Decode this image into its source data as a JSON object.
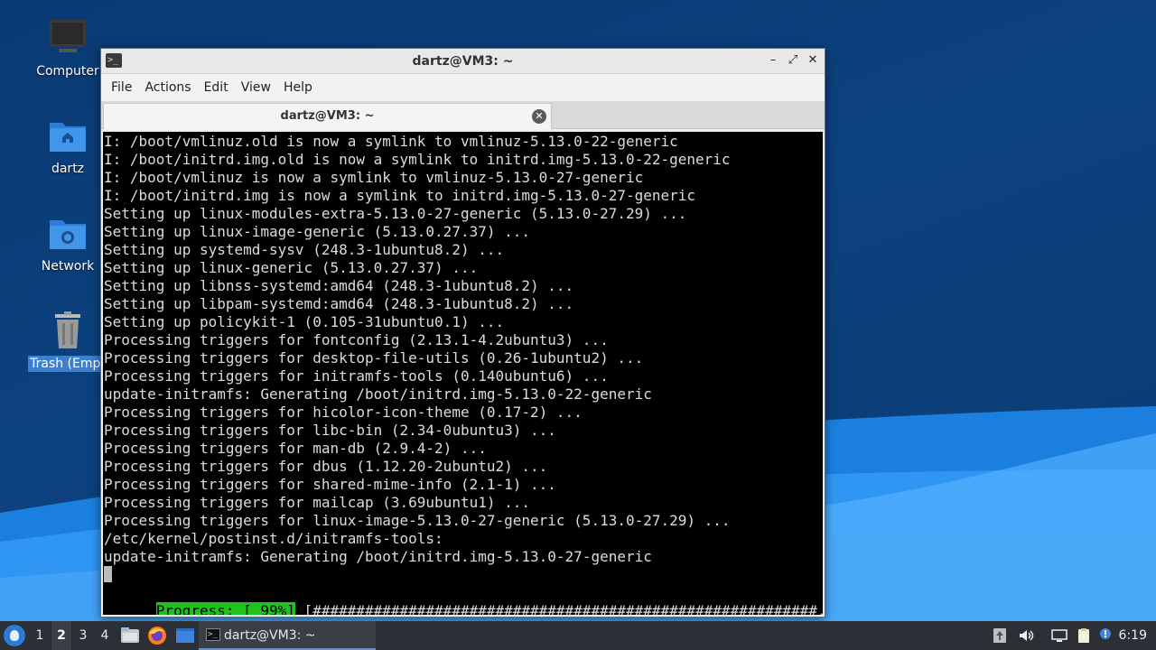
{
  "desktop": {
    "icons": [
      {
        "label": "Computer"
      },
      {
        "label": "dartz"
      },
      {
        "label": "Network"
      },
      {
        "label": "Trash (Empt"
      }
    ]
  },
  "window": {
    "title": "dartz@VM3: ~",
    "app_icon_glyph": ">_",
    "controls": {
      "minimize": "–",
      "maximize": "⤢",
      "close": "✕"
    },
    "menu": [
      "File",
      "Actions",
      "Edit",
      "View",
      "Help"
    ],
    "tab": {
      "label": "dartz@VM3: ~",
      "close_glyph": "✕"
    }
  },
  "terminal": {
    "lines": [
      "I: /boot/vmlinuz.old is now a symlink to vmlinuz-5.13.0-22-generic",
      "I: /boot/initrd.img.old is now a symlink to initrd.img-5.13.0-22-generic",
      "I: /boot/vmlinuz is now a symlink to vmlinuz-5.13.0-27-generic",
      "I: /boot/initrd.img is now a symlink to initrd.img-5.13.0-27-generic",
      "Setting up linux-modules-extra-5.13.0-27-generic (5.13.0-27.29) ...",
      "Setting up linux-image-generic (5.13.0.27.37) ...",
      "Setting up systemd-sysv (248.3-1ubuntu8.2) ...",
      "Setting up linux-generic (5.13.0.27.37) ...",
      "Setting up libnss-systemd:amd64 (248.3-1ubuntu8.2) ...",
      "Setting up libpam-systemd:amd64 (248.3-1ubuntu8.2) ...",
      "Setting up policykit-1 (0.105-31ubuntu0.1) ...",
      "Processing triggers for fontconfig (2.13.1-4.2ubuntu3) ...",
      "Processing triggers for desktop-file-utils (0.26-1ubuntu2) ...",
      "Processing triggers for initramfs-tools (0.140ubuntu6) ...",
      "update-initramfs: Generating /boot/initrd.img-5.13.0-22-generic",
      "Processing triggers for hicolor-icon-theme (0.17-2) ...",
      "Processing triggers for libc-bin (2.34-0ubuntu3) ...",
      "Processing triggers for man-db (2.9.4-2) ...",
      "Processing triggers for dbus (1.12.20-2ubuntu2) ...",
      "Processing triggers for shared-mime-info (2.1-1) ...",
      "Processing triggers for mailcap (3.69ubuntu1) ...",
      "Processing triggers for linux-image-5.13.0-27-generic (5.13.0-27.29) ...",
      "/etc/kernel/postinst.d/initramfs-tools:",
      "update-initramfs: Generating /boot/initrd.img-5.13.0-27-generic"
    ],
    "progress_label": "Progress: [ 99%]",
    "progress_bar": " [##########################################################.] "
  },
  "taskbar": {
    "workspaces": [
      "1",
      "2",
      "3",
      "4"
    ],
    "active_workspace": "2",
    "task_label": "dartz@VM3: ~",
    "task_icon_glyph": ">_",
    "clock": "6:19"
  },
  "colors": {
    "progress_highlight": "#1fc21f",
    "terminal_bg": "#000000",
    "terminal_fg": "#dcdcdc",
    "taskbar_bg": "#2c3036"
  }
}
